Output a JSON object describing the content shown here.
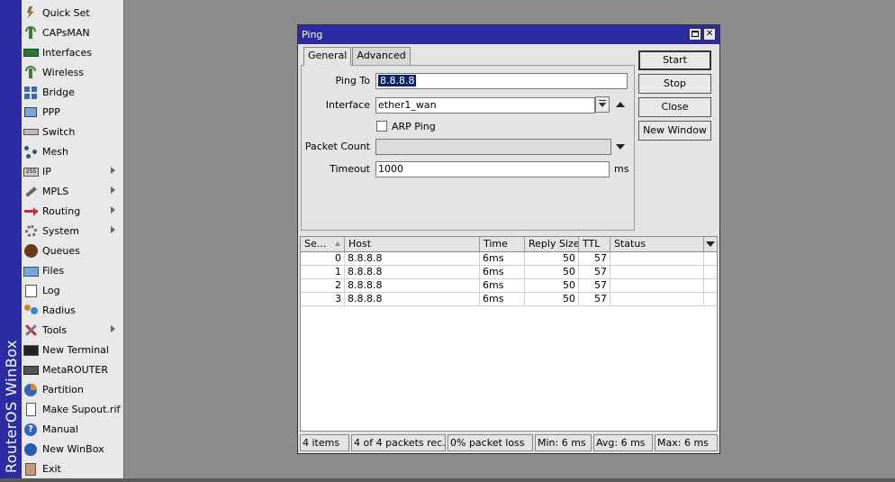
{
  "brand": "RouterOS WinBox",
  "sidebar": {
    "items": [
      {
        "label": "Quick Set",
        "icon": "quick-set-icon",
        "submenu": false
      },
      {
        "label": "CAPsMAN",
        "icon": "capsman-icon",
        "submenu": false
      },
      {
        "label": "Interfaces",
        "icon": "interfaces-icon",
        "submenu": false
      },
      {
        "label": "Wireless",
        "icon": "wireless-icon",
        "submenu": false
      },
      {
        "label": "Bridge",
        "icon": "bridge-icon",
        "submenu": false
      },
      {
        "label": "PPP",
        "icon": "ppp-icon",
        "submenu": false
      },
      {
        "label": "Switch",
        "icon": "switch-icon",
        "submenu": false
      },
      {
        "label": "Mesh",
        "icon": "mesh-icon",
        "submenu": false
      },
      {
        "label": "IP",
        "icon": "ip-icon",
        "submenu": true
      },
      {
        "label": "MPLS",
        "icon": "mpls-icon",
        "submenu": true
      },
      {
        "label": "Routing",
        "icon": "routing-icon",
        "submenu": true
      },
      {
        "label": "System",
        "icon": "system-gear-icon",
        "submenu": true
      },
      {
        "label": "Queues",
        "icon": "queues-icon",
        "submenu": false
      },
      {
        "label": "Files",
        "icon": "folder-icon",
        "submenu": false
      },
      {
        "label": "Log",
        "icon": "log-icon",
        "submenu": false
      },
      {
        "label": "Radius",
        "icon": "radius-users-icon",
        "submenu": false
      },
      {
        "label": "Tools",
        "icon": "tools-icon",
        "submenu": true
      },
      {
        "label": "New Terminal",
        "icon": "terminal-icon",
        "submenu": false
      },
      {
        "label": "MetaROUTER",
        "icon": "metarouter-icon",
        "submenu": false
      },
      {
        "label": "Partition",
        "icon": "partition-icon",
        "submenu": false
      },
      {
        "label": "Make Supout.rif",
        "icon": "document-icon",
        "submenu": false
      },
      {
        "label": "Manual",
        "icon": "help-icon",
        "submenu": false
      },
      {
        "label": "New WinBox",
        "icon": "winbox-globe-icon",
        "submenu": false
      },
      {
        "label": "Exit",
        "icon": "exit-icon",
        "submenu": false
      }
    ]
  },
  "window": {
    "title": "Ping",
    "tabs": [
      "General",
      "Advanced"
    ],
    "form": {
      "ping_to_label": "Ping To",
      "ping_to_value": "8.8.8.8",
      "interface_label": "Interface",
      "interface_value": "ether1_wan",
      "arp_ping_label": "ARP Ping",
      "packet_count_label": "Packet Count",
      "packet_count_value": "",
      "timeout_label": "Timeout",
      "timeout_value": "1000",
      "timeout_unit": "ms"
    },
    "buttons": {
      "start": "Start",
      "stop": "Stop",
      "close": "Close",
      "new_window": "New Window"
    },
    "table": {
      "columns": [
        "Se...",
        "Host",
        "Time",
        "Reply Size",
        "TTL",
        "Status"
      ],
      "rows": [
        {
          "seq": "0",
          "host": "8.8.8.8",
          "time": "6ms",
          "size": "50",
          "ttl": "57",
          "status": ""
        },
        {
          "seq": "1",
          "host": "8.8.8.8",
          "time": "6ms",
          "size": "50",
          "ttl": "57",
          "status": ""
        },
        {
          "seq": "2",
          "host": "8.8.8.8",
          "time": "6ms",
          "size": "50",
          "ttl": "57",
          "status": ""
        },
        {
          "seq": "3",
          "host": "8.8.8.8",
          "time": "6ms",
          "size": "50",
          "ttl": "57",
          "status": ""
        }
      ]
    },
    "status": {
      "items": "4 items",
      "packets": "4 of 4 packets rec...",
      "loss": "0% packet loss",
      "min": "Min: 6 ms",
      "avg": "Avg: 6 ms",
      "max": "Max: 6 ms"
    }
  },
  "colors": {
    "titlebar": "#2b2ba3",
    "desktop": "#8c8c8c",
    "selection": "#0a246a"
  }
}
